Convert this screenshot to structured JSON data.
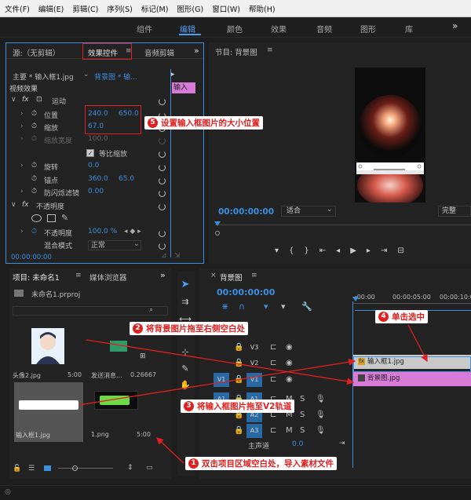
{
  "menu": [
    "文件(F)",
    "编辑(E)",
    "剪辑(C)",
    "序列(S)",
    "标记(M)",
    "图形(G)",
    "窗口(W)",
    "帮助(H)"
  ],
  "workspace_tabs": [
    "组件",
    "编辑",
    "颜色",
    "效果",
    "音频",
    "图形",
    "库"
  ],
  "workspace_active": "编辑",
  "more_icon": "»",
  "effect_panel": {
    "tab_source": "源:（无剪辑）",
    "tab_effects": "效果控件",
    "tab_audio": "音频剪辑",
    "master": "主要 * 输入框1.jpg",
    "sequence": "背景图 * 输...",
    "clip_chip": "输入",
    "video_effects": "视频效果",
    "motion": "运动",
    "position_label": "位置",
    "position_x": "240.0",
    "position_y": "650.0",
    "scale_label": "缩放",
    "scale_value": "67.0",
    "scale_width_label": "缩放宽度",
    "scale_width_value": "100.0",
    "uniform_scale_label": "等比缩放",
    "rotation_label": "旋转",
    "rotation_value": "0.0",
    "anchor_label": "锚点",
    "anchor_x": "360.0",
    "anchor_y": "65.0",
    "antiflicker_label": "防闪烁滤镜",
    "antiflicker_value": "0.00",
    "opacity_section": "不透明度",
    "opacity_label": "不透明度",
    "opacity_value": "100.0 %",
    "blend_label": "混合模式",
    "blend_value": "正常",
    "timecode": "00:00:00:00"
  },
  "program_monitor": {
    "title": "节目: 背景图",
    "timecode": "00:00:00:00",
    "fit": "适合",
    "quality": "完整"
  },
  "project_panel": {
    "title": "项目: 未命名1",
    "tab_media": "媒体浏览器",
    "project_file": "未命名1.prproj",
    "items": [
      {
        "name": "头像2.jpg",
        "duration": "5:00"
      },
      {
        "name": "发送消息...",
        "duration": "0.26667"
      },
      {
        "name": "输入框1.jpg",
        "duration": "5:00"
      },
      {
        "name": "1.png",
        "duration": "5:00"
      }
    ]
  },
  "timeline": {
    "title": "背景图",
    "timecode": "00:00:00:00",
    "ruler": [
      ":00:00",
      "00:00:05:00",
      "00:00:10:00"
    ],
    "tracks": [
      "V3",
      "V2",
      "V1",
      "A1",
      "A2",
      "A3"
    ],
    "source_v1": "V1",
    "source_a1": "A1",
    "master_label": "主声道",
    "master_value": "0.0",
    "clip_v2": "输入框1.jpg",
    "clip_v1": "背景图.jpg",
    "track_m": "M",
    "track_s": "S"
  },
  "annotations": {
    "a1_num": "1",
    "a1": "双击项目区域空白处，导入素材文件",
    "a2_num": "2",
    "a2": "将背景图片拖至右侧空白处",
    "a3_num": "3",
    "a3": "将输入框图片拖至V2轨道",
    "a4_num": "4",
    "a4": "单击选中",
    "a5_num": "5",
    "a5": "设置输入框图片的大小位置"
  },
  "colors": {
    "accent": "#3d8fe0",
    "annotation": "#e02020",
    "clip_pink": "#d87ad8",
    "clip_gray": "#c9c9c9"
  }
}
